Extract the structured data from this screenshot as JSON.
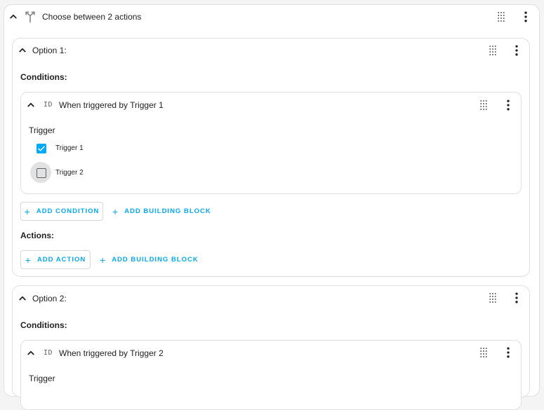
{
  "choose": {
    "title": "Choose between 2 actions",
    "options": [
      {
        "title": "Option 1:",
        "conditions_label": "Conditions:",
        "condition": {
          "type_badge": "ID",
          "title": "When triggered by Trigger 1",
          "field_label": "Trigger",
          "choices": [
            {
              "label": "Trigger 1",
              "checked": true
            },
            {
              "label": "Trigger 2",
              "checked": false
            }
          ]
        },
        "add_condition_label": "ADD CONDITION",
        "add_building_block_label": "ADD BUILDING BLOCK",
        "actions_label": "Actions:",
        "add_action_label": "ADD ACTION",
        "add_action_building_block_label": "ADD BUILDING BLOCK"
      },
      {
        "title": "Option 2:",
        "conditions_label": "Conditions:",
        "condition": {
          "type_badge": "ID",
          "title": "When triggered by Trigger 2",
          "field_label": "Trigger"
        }
      }
    ]
  },
  "icons": {
    "collapse": "chevron-up-icon",
    "drag": "drag-handle-icon",
    "menu": "more-vertical-icon",
    "choose_type": "split-arrows-icon",
    "add": "plus-icon",
    "check": "check-icon"
  },
  "colors": {
    "accent": "#03a9f4",
    "border": "#e0e0e0",
    "background": "#f4f4f4"
  }
}
